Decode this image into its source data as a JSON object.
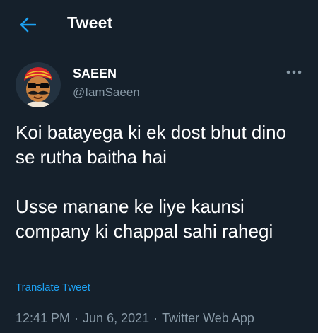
{
  "colors": {
    "background": "#15202b",
    "accent": "#1da1f2",
    "text_primary": "#ffffff",
    "text_secondary": "#8899a6",
    "divider": "#38444d"
  },
  "header": {
    "back_icon": "arrow-left-icon",
    "title": "Tweet"
  },
  "author": {
    "display_name": "SAEEN",
    "handle": "@IamSaeen",
    "avatar_icon": "cartoon-avatar"
  },
  "more_icon": "more-horizontal-icon",
  "tweet": {
    "text": "Koi batayega ki ek dost bhut dino se rutha baitha hai\n\nUsse manane ke liye kaunsi company ki chappal sahi rahegi",
    "translate_label": "Translate Tweet"
  },
  "meta": {
    "time": "12:41 PM",
    "separator": "·",
    "date": "Jun 6, 2021",
    "source": "Twitter Web App"
  }
}
